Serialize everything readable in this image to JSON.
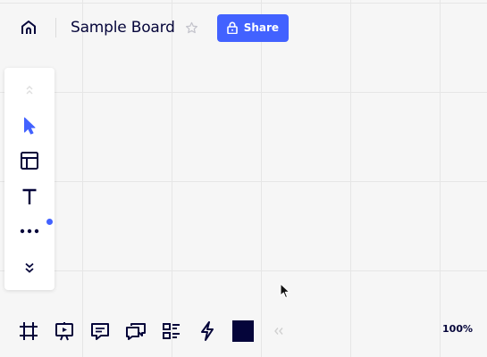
{
  "header": {
    "board_title": "Sample Board",
    "share_label": "Share"
  },
  "icons": {
    "home": "home-icon",
    "star": "star-icon",
    "lock": "lock-icon",
    "scroll_up": "chevron-up-icon",
    "select": "cursor-icon",
    "templates": "layout-icon",
    "text": "text-icon",
    "more": "more-icon",
    "expand": "double-chevron-down-icon",
    "frames": "frame-icon",
    "present": "presentation-icon",
    "comments": "comment-icon",
    "chat": "chat-icon",
    "cards": "card-list-icon",
    "integrations": "lightning-icon",
    "collapse": "double-chevron-left-icon"
  },
  "colors": {
    "accent": "#4262ff",
    "ink": "#05053a",
    "selected_color": "#05053a"
  },
  "footer": {
    "zoom": "100%"
  }
}
